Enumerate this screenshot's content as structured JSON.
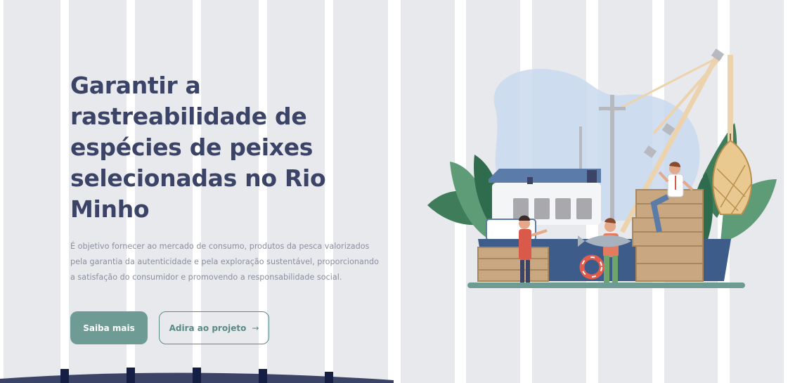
{
  "hero": {
    "title": "Garantir a rastreabilidade de espécies de peixes selecionadas no Rio Minho",
    "description": "É objetivo fornecer ao mercado de consumo, produtos da pesca valorizados pela garantia da autenticidade e pela exploração sustentável, proporcionando a satisfação do consumidor e promovendo a responsabilidade social.",
    "buttons": {
      "primary_label": "Saiba mais",
      "secondary_label": "Adira ao projeto",
      "secondary_arrow": "→"
    }
  },
  "colors": {
    "title": "#3b4467",
    "text": "#8b8f9e",
    "accent": "#6e9c94",
    "stripe": "#e8e9ed",
    "wave": "#3b4467"
  },
  "illustration": {
    "icon": "fishing-boat-illustration"
  }
}
